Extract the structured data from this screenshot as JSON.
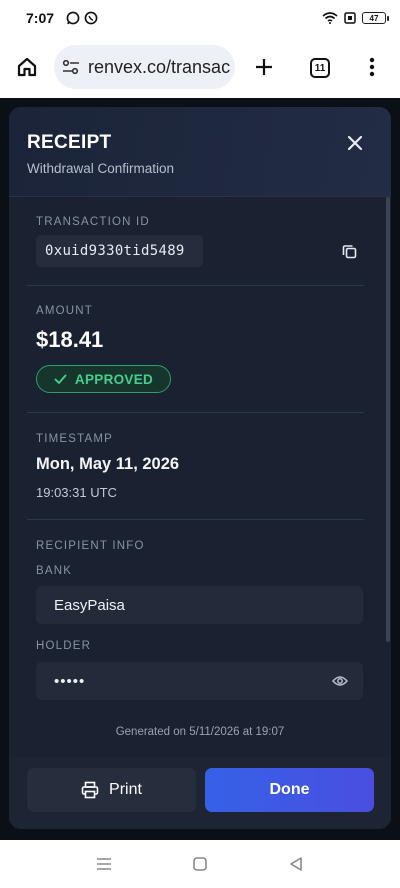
{
  "status_bar": {
    "time": "7:07",
    "battery": "47"
  },
  "browser": {
    "url": "renvex.co/transac",
    "tab_count": "11"
  },
  "receipt": {
    "title": "RECEIPT",
    "subtitle": "Withdrawal Confirmation",
    "transaction": {
      "label": "TRANSACTION ID",
      "value": "0xuid9330tid5489"
    },
    "amount": {
      "label": "AMOUNT",
      "value": "$18.41",
      "status": "APPROVED"
    },
    "timestamp": {
      "label": "TIMESTAMP",
      "date": "Mon, May 11, 2026",
      "time": "19:03:31 UTC"
    },
    "recipient": {
      "label": "RECIPIENT INFO",
      "bank_label": "BANK",
      "bank_value": "EasyPaisa",
      "holder_label": "HOLDER",
      "holder_value": "•••••"
    },
    "generated": "Generated on 5/11/2026 at 19:07",
    "buttons": {
      "print": "Print",
      "done": "Done"
    }
  },
  "colors": {
    "accent": "#3561e8",
    "approved": "#43d08a",
    "card_bg": "#1a2130"
  },
  "icons": {
    "home": "home-icon",
    "site_settings": "tune-icon",
    "new_tab": "plus-icon",
    "menu": "more-vert-icon",
    "close": "close-icon",
    "copy": "copy-icon",
    "check": "check-icon",
    "eye": "eye-icon",
    "print": "printer-icon"
  }
}
